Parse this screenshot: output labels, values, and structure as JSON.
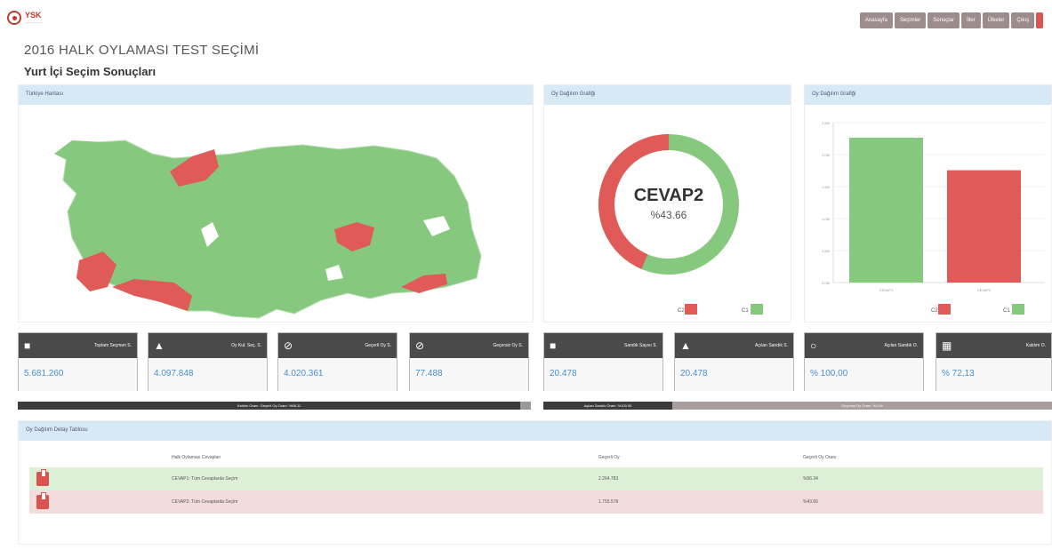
{
  "header": {
    "logo_text": "YSK",
    "nav": [
      "Anasayfa",
      "Seçimler",
      "Sonuçlar",
      "İller",
      "Ülkeler",
      "Çıkış"
    ]
  },
  "page": {
    "title": "2016 HALK OYLAMASI TEST SEÇİMİ",
    "subtitle": "Yurt İçi Seçim Sonuçları"
  },
  "panels": {
    "map_title": "Türkiye Haritası",
    "donut_title": "Oy Dağılım Grafiği",
    "bar_title": "Oy Dağılım Grafiği"
  },
  "donut": {
    "center_label": "CEVAP2",
    "center_value": "%43.66",
    "legend": [
      "C2",
      "C1"
    ],
    "red_fraction": 0.4366
  },
  "stats": [
    {
      "label": "Toplam Seçmen S.",
      "value": "5.681.260",
      "icon": "users-icon"
    },
    {
      "label": "Oy Kul. Seç. S.",
      "value": "4.097.848",
      "icon": "user-icon"
    },
    {
      "label": "Geçerli Oy S.",
      "value": "4.020.361",
      "icon": "check-circle-icon"
    },
    {
      "label": "Geçersiz Oy S.",
      "value": "77.488",
      "icon": "ban-icon"
    },
    {
      "label": "Sandık Sayısı S.",
      "value": "20.478",
      "icon": "box-icon"
    },
    {
      "label": "Açılan Sandık S.",
      "value": "20.478",
      "icon": "unlock-icon"
    },
    {
      "label": "Açılan Sandık O.",
      "value": "% 100,00",
      "icon": "thumbs-up-icon"
    },
    {
      "label": "Katılım O.",
      "value": "% 72,13",
      "icon": "chart-icon"
    }
  ],
  "strips": {
    "left": "Katılım Oranı: Geçerli Oy Oranı: %98.11",
    "mid": "Açılan Sandık Oranı: %100.00",
    "right": "Geçersiz Oy Oranı: %1.89"
  },
  "table": {
    "title": "Oy Dağılım Detay Tablosu",
    "headers": [
      "",
      "Halk Oylaması Cevapları",
      "Geçerli Oy",
      "Geçerli Oy Oranı"
    ],
    "rows": [
      {
        "answer": "CEVAP1: Tüm Cevaplarda Seçim",
        "votes": "2.264.783",
        "ratio": "%56.34"
      },
      {
        "answer": "CEVAP2: Tüm Cevaplarda Seçim",
        "votes": "1.755.578",
        "ratio": "%43.66"
      }
    ]
  },
  "chart_data": {
    "type": "bar",
    "categories": [
      "CEVAP1",
      "CEVAP2"
    ],
    "values": [
      2264783,
      1755578
    ],
    "ylim": [
      0,
      2500000
    ],
    "colors": [
      "#86c97e",
      "#e05a57"
    ],
    "legend": [
      "C2",
      "C1"
    ]
  },
  "colors": {
    "green": "#86c97e",
    "red": "#e05a57"
  }
}
